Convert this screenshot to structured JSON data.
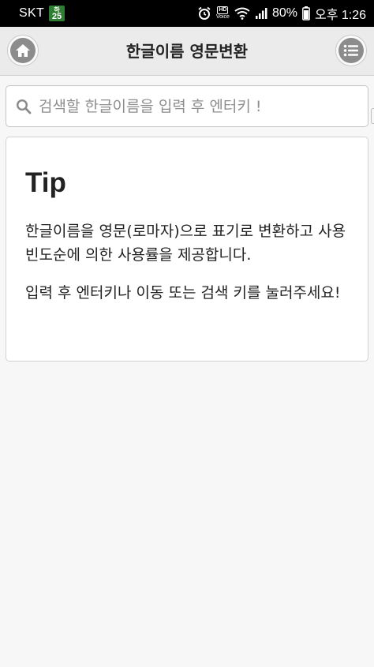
{
  "status_bar": {
    "carrier": "SKT",
    "badge_top": "하",
    "badge_bottom": "25",
    "hd_label": "HD",
    "voice_label": "Voice",
    "battery": "80%",
    "time": "오후 1:26",
    "icons": [
      "alarm-icon",
      "hd-voice-icon",
      "wifi-icon",
      "signal-icon",
      "battery-icon"
    ]
  },
  "header": {
    "title": "한글이름 영문변환",
    "left_icon": "home-icon",
    "right_icon": "list-menu-icon"
  },
  "search": {
    "placeholder": "검색할 한글이름을 입력 후 엔터키 !",
    "value": ""
  },
  "tip": {
    "title": "Tip",
    "paragraphs": [
      "한글이름을 영문(로마자)으로 표기로 변환하고 사용 빈도순에 의한 사용률을 제공합니다.",
      "입력 후 엔터키나 이동 또는 검색 키를 눌러주세요!"
    ]
  },
  "colors": {
    "header_bg": "#ebebeb",
    "page_bg": "#f7f7f7",
    "icon_gray": "#8c8c8c",
    "status_bar_bg": "#000000",
    "badge_green": "#2e7d32"
  }
}
